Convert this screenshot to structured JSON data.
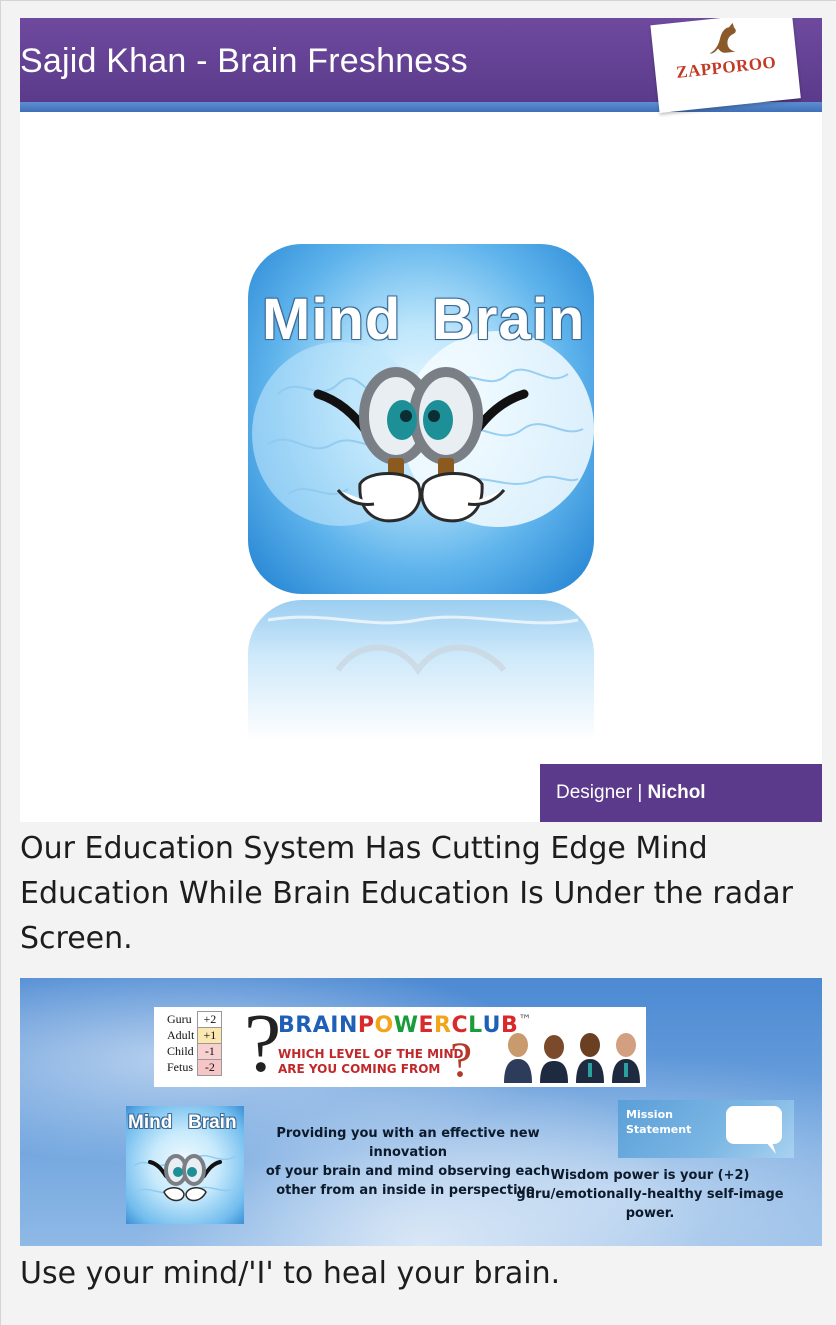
{
  "slide1": {
    "title": "Sajid Khan - Brain Freshness",
    "brand": "ZAPPOROO",
    "icon_word_left": "Mind",
    "icon_word_right": "Brain",
    "designer_label": "Designer | ",
    "designer_name": "Nichol"
  },
  "caption1": "Our Education System Has Cutting Edge Mind Education While Brain Education Is Under the radar Screen.",
  "slide2": {
    "levels": [
      {
        "label": "Guru",
        "value": "+2"
      },
      {
        "label": "Adult",
        "value": "+1"
      },
      {
        "label": "Child",
        "value": "-1"
      },
      {
        "label": "Fetus",
        "value": "-2"
      }
    ],
    "question_mark": "?",
    "club_title_words": [
      {
        "text": "B",
        "color": "#1f5fb8"
      },
      {
        "text": "R",
        "color": "#1f5fb8"
      },
      {
        "text": "A",
        "color": "#1f5fb8"
      },
      {
        "text": "I",
        "color": "#1f5fb8"
      },
      {
        "text": "N ",
        "color": "#1f5fb8"
      },
      {
        "text": "P",
        "color": "#d9292b"
      },
      {
        "text": "O",
        "color": "#f2a51b"
      },
      {
        "text": "W",
        "color": "#1a9c3b"
      },
      {
        "text": "E",
        "color": "#d9292b"
      },
      {
        "text": "R ",
        "color": "#f2a51b"
      },
      {
        "text": "C",
        "color": "#d9292b"
      },
      {
        "text": "L",
        "color": "#1a9c3b"
      },
      {
        "text": "U",
        "color": "#1f5fb8"
      },
      {
        "text": "B",
        "color": "#d9292b"
      },
      {
        "text": "™",
        "color": "#555555"
      }
    ],
    "club_subtitle": "WHICH LEVEL OF THE MIND\nARE YOU COMING FROM",
    "mini_icon_left": "Mind",
    "mini_icon_right": "Brain",
    "providing": "Providing you with an effective new innovation\nof your brain and mind observing each\nother from an inside in perspective.",
    "mission": "Mission\nStatement",
    "wisdom": "Wisdom power is your (+2)\nguru/emotionally-healthy self-image power."
  },
  "caption2": "Use your mind/'I' to heal your brain.",
  "colors": {
    "header_purple": "#5b3a8b",
    "header_blue_bar": "#3f6fb7",
    "brand_red": "#c23a25"
  }
}
